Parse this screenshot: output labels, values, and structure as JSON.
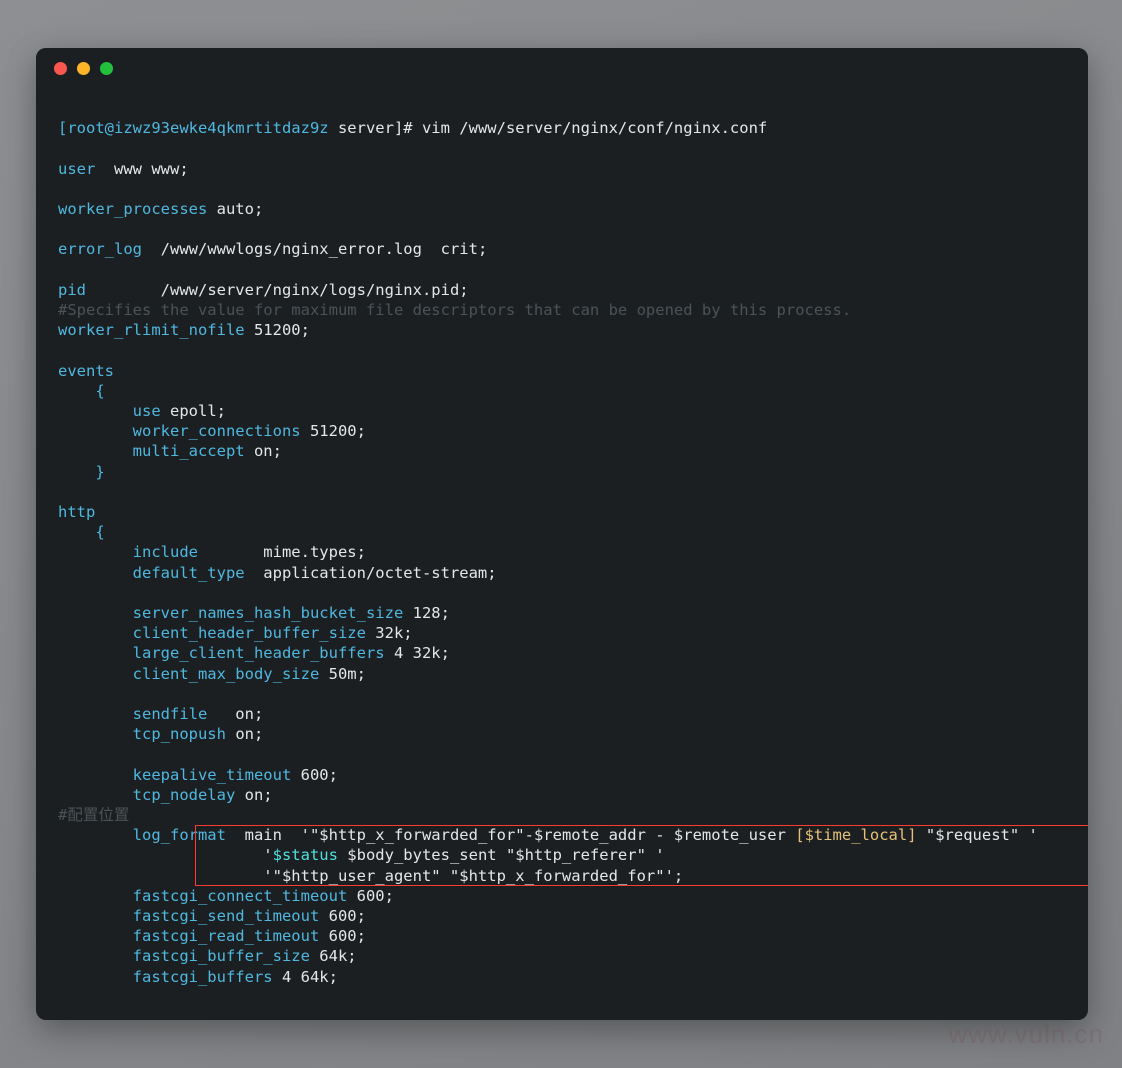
{
  "window": {
    "title": "terminal",
    "controls": [
      {
        "name": "close",
        "color": "#f9564f"
      },
      {
        "name": "minimize",
        "color": "#fbb527"
      },
      {
        "name": "maximize",
        "color": "#22c03c"
      }
    ]
  },
  "watermark": "www.vuln.cn",
  "terminal": {
    "prompt": {
      "bracket_user_host": "[root@izwz93ewke4qkmrtitdaz9z",
      "cwd_and_sigil": "server]#",
      "command": "vim /www/server/nginx/conf/nginx.conf"
    },
    "lines": {
      "user_kw": "user",
      "user_val": "  www www;",
      "worker_processes_kw": "worker_processes",
      "worker_processes_val": " auto;",
      "error_log_kw": "error_log",
      "error_log_val": "  /www/wwwlogs/nginx_error.log  crit;",
      "pid_kw": "pid",
      "pid_val": "        /www/server/nginx/logs/nginx.pid;",
      "comment_fd": "#Specifies the value for maximum file descriptors that can be opened by this process.",
      "worker_rlimit_kw": "worker_rlimit_nofile",
      "worker_rlimit_val": " 51200;",
      "events_kw": "events",
      "events_open_brace": "    {",
      "use_kw": "        use",
      "use_val": " epoll;",
      "worker_connections_kw": "        worker_connections",
      "worker_connections_val": " 51200;",
      "multi_accept_kw": "        multi_accept",
      "multi_accept_val": " on;",
      "events_close_brace": "    }",
      "http_kw": "http",
      "http_open_brace": "    {",
      "include_kw": "        include",
      "include_val": "       mime.types;",
      "default_type_kw": "        default_type",
      "default_type_val": "  application/octet-stream;",
      "server_names_hash_kw": "        server_names_hash_bucket_size",
      "server_names_hash_val": " 128;",
      "client_header_buffer_kw": "        client_header_buffer_size",
      "client_header_buffer_val": " 32k;",
      "large_client_header_kw": "        large_client_header_buffers",
      "large_client_header_val": " 4 32k;",
      "client_max_body_kw": "        client_max_body_size",
      "client_max_body_val": " 50m;",
      "sendfile_kw": "        sendfile",
      "sendfile_val": "   on;",
      "tcp_nopush_kw": "        tcp_nopush",
      "tcp_nopush_val": " on;",
      "keepalive_timeout_kw": "        keepalive_timeout",
      "keepalive_timeout_val": " 600;",
      "tcp_nodelay_kw": "        tcp_nodelay",
      "tcp_nodelay_val": " on;",
      "comment_location": "#配置位置",
      "log_format_kw": "        log_format",
      "log_format_name": "  main",
      "log_format_part1": "  '\"$http_x_forwarded_for\"-$remote_addr - $remote_user ",
      "log_format_time_local": "[$time_local]",
      "log_format_part1_tail": " \"$request\" '",
      "log_format_line2_indent": "                      '",
      "log_format_status": "$status",
      "log_format_line2_tail": " $body_bytes_sent \"$http_referer\" '",
      "log_format_line3": "                      '\"$http_user_agent\" \"$http_x_forwarded_for\"';",
      "fastcgi_connect_kw": "        fastcgi_connect_timeout",
      "fastcgi_connect_val": " 600;",
      "fastcgi_send_kw": "        fastcgi_send_timeout",
      "fastcgi_send_val": " 600;",
      "fastcgi_read_kw": "        fastcgi_read_timeout",
      "fastcgi_read_val": " 600;",
      "fastcgi_buffer_size_kw": "        fastcgi_buffer_size",
      "fastcgi_buffer_size_val": " 64k;",
      "fastcgi_buffers_kw": "        fastcgi_buffers",
      "fastcgi_buffers_val": " 4 64k;"
    }
  },
  "colors": {
    "page_background": "#8a8c8f",
    "terminal_background": "#1c1f21",
    "keyword": "#4fb8e0",
    "value": "#e3e7e7",
    "comment": "#4b5356",
    "cyan_variable": "#4fe0e0",
    "gold_variable": "#e5c07b",
    "highlight_border": "#ff3b30"
  }
}
